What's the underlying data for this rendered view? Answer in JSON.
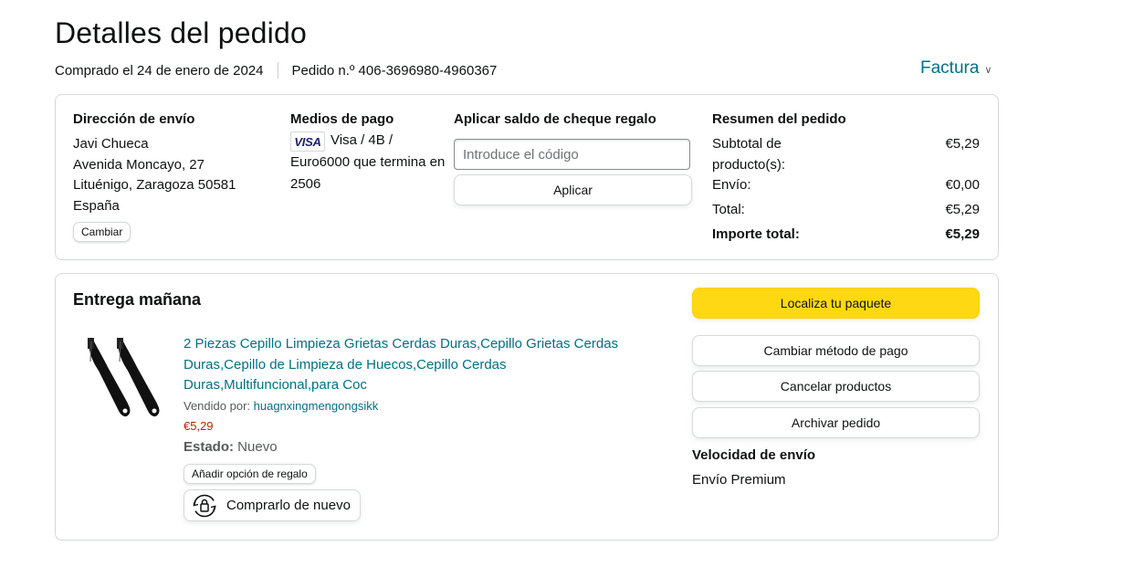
{
  "header": {
    "title": "Detalles del pedido",
    "purchased": "Comprado el 24 de enero de 2024",
    "order_number": "Pedido n.º 406-3696980-4960367",
    "invoice_label": "Factura"
  },
  "shipping": {
    "heading": "Dirección de envío",
    "lines": [
      "Javi Chueca",
      "Avenida Moncayo, 27",
      "Lituénigo, Zaragoza 50581",
      "España"
    ],
    "change_label": "Cambiar"
  },
  "payment": {
    "heading": "Medios de pago",
    "card_brand": "VISA",
    "card_text": "Visa / 4B / Euro6000 que termina en 2506"
  },
  "gift": {
    "heading": "Aplicar saldo de cheque regalo",
    "placeholder": "Introduce el código",
    "apply_label": "Aplicar"
  },
  "summary": {
    "heading": "Resumen del pedido",
    "subtotal_label": "Subtotal de producto(s):",
    "subtotal_value": "€5,29",
    "shipping_label": "Envío:",
    "shipping_value": "€0,00",
    "total_label": "Total:",
    "total_value": "€5,29",
    "grand_label": "Importe total:",
    "grand_value": "€5,29"
  },
  "delivery": {
    "heading": "Entrega mañana",
    "product": {
      "title": "2 Piezas Cepillo Limpieza Grietas Cerdas Duras,Cepillo Grietas Cerdas Duras,Cepillo de Limpieza de Huecos,Cepillo Cerdas Duras,Multifuncional,para Coc",
      "sold_by_label": "Vendido por: ",
      "seller": "huagnxingmengongsikk",
      "price": "€5,29",
      "status_label": "Estado:",
      "status_value": " Nuevo",
      "gift_option_label": "Añadir opción de regalo",
      "buy_again_label": "Comprarlo de nuevo"
    },
    "actions": {
      "track": "Localiza tu paquete",
      "change_payment": "Cambiar método de pago",
      "cancel": "Cancelar productos",
      "archive": "Archivar pedido"
    },
    "speed_heading": "Velocidad de envío",
    "speed_value": "Envío Premium"
  },
  "colors": {
    "link": "#007185",
    "price": "#b12704",
    "primary_button": "#ffd814",
    "border": "#d5d9d9"
  }
}
